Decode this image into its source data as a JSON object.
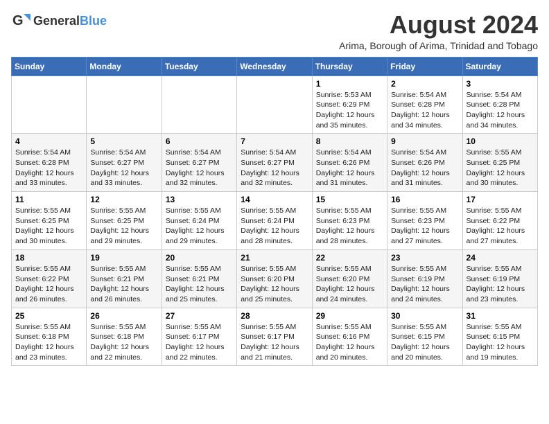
{
  "header": {
    "logo_general": "General",
    "logo_blue": "Blue",
    "main_title": "August 2024",
    "subtitle": "Arima, Borough of Arima, Trinidad and Tobago"
  },
  "days_of_week": [
    "Sunday",
    "Monday",
    "Tuesday",
    "Wednesday",
    "Thursday",
    "Friday",
    "Saturday"
  ],
  "weeks": [
    [
      {
        "day": "",
        "content": ""
      },
      {
        "day": "",
        "content": ""
      },
      {
        "day": "",
        "content": ""
      },
      {
        "day": "",
        "content": ""
      },
      {
        "day": "1",
        "content": "Sunrise: 5:53 AM\nSunset: 6:29 PM\nDaylight: 12 hours\nand 35 minutes."
      },
      {
        "day": "2",
        "content": "Sunrise: 5:54 AM\nSunset: 6:28 PM\nDaylight: 12 hours\nand 34 minutes."
      },
      {
        "day": "3",
        "content": "Sunrise: 5:54 AM\nSunset: 6:28 PM\nDaylight: 12 hours\nand 34 minutes."
      }
    ],
    [
      {
        "day": "4",
        "content": "Sunrise: 5:54 AM\nSunset: 6:28 PM\nDaylight: 12 hours\nand 33 minutes."
      },
      {
        "day": "5",
        "content": "Sunrise: 5:54 AM\nSunset: 6:27 PM\nDaylight: 12 hours\nand 33 minutes."
      },
      {
        "day": "6",
        "content": "Sunrise: 5:54 AM\nSunset: 6:27 PM\nDaylight: 12 hours\nand 32 minutes."
      },
      {
        "day": "7",
        "content": "Sunrise: 5:54 AM\nSunset: 6:27 PM\nDaylight: 12 hours\nand 32 minutes."
      },
      {
        "day": "8",
        "content": "Sunrise: 5:54 AM\nSunset: 6:26 PM\nDaylight: 12 hours\nand 31 minutes."
      },
      {
        "day": "9",
        "content": "Sunrise: 5:54 AM\nSunset: 6:26 PM\nDaylight: 12 hours\nand 31 minutes."
      },
      {
        "day": "10",
        "content": "Sunrise: 5:55 AM\nSunset: 6:25 PM\nDaylight: 12 hours\nand 30 minutes."
      }
    ],
    [
      {
        "day": "11",
        "content": "Sunrise: 5:55 AM\nSunset: 6:25 PM\nDaylight: 12 hours\nand 30 minutes."
      },
      {
        "day": "12",
        "content": "Sunrise: 5:55 AM\nSunset: 6:25 PM\nDaylight: 12 hours\nand 29 minutes."
      },
      {
        "day": "13",
        "content": "Sunrise: 5:55 AM\nSunset: 6:24 PM\nDaylight: 12 hours\nand 29 minutes."
      },
      {
        "day": "14",
        "content": "Sunrise: 5:55 AM\nSunset: 6:24 PM\nDaylight: 12 hours\nand 28 minutes."
      },
      {
        "day": "15",
        "content": "Sunrise: 5:55 AM\nSunset: 6:23 PM\nDaylight: 12 hours\nand 28 minutes."
      },
      {
        "day": "16",
        "content": "Sunrise: 5:55 AM\nSunset: 6:23 PM\nDaylight: 12 hours\nand 27 minutes."
      },
      {
        "day": "17",
        "content": "Sunrise: 5:55 AM\nSunset: 6:22 PM\nDaylight: 12 hours\nand 27 minutes."
      }
    ],
    [
      {
        "day": "18",
        "content": "Sunrise: 5:55 AM\nSunset: 6:22 PM\nDaylight: 12 hours\nand 26 minutes."
      },
      {
        "day": "19",
        "content": "Sunrise: 5:55 AM\nSunset: 6:21 PM\nDaylight: 12 hours\nand 26 minutes."
      },
      {
        "day": "20",
        "content": "Sunrise: 5:55 AM\nSunset: 6:21 PM\nDaylight: 12 hours\nand 25 minutes."
      },
      {
        "day": "21",
        "content": "Sunrise: 5:55 AM\nSunset: 6:20 PM\nDaylight: 12 hours\nand 25 minutes."
      },
      {
        "day": "22",
        "content": "Sunrise: 5:55 AM\nSunset: 6:20 PM\nDaylight: 12 hours\nand 24 minutes."
      },
      {
        "day": "23",
        "content": "Sunrise: 5:55 AM\nSunset: 6:19 PM\nDaylight: 12 hours\nand 24 minutes."
      },
      {
        "day": "24",
        "content": "Sunrise: 5:55 AM\nSunset: 6:19 PM\nDaylight: 12 hours\nand 23 minutes."
      }
    ],
    [
      {
        "day": "25",
        "content": "Sunrise: 5:55 AM\nSunset: 6:18 PM\nDaylight: 12 hours\nand 23 minutes."
      },
      {
        "day": "26",
        "content": "Sunrise: 5:55 AM\nSunset: 6:18 PM\nDaylight: 12 hours\nand 22 minutes."
      },
      {
        "day": "27",
        "content": "Sunrise: 5:55 AM\nSunset: 6:17 PM\nDaylight: 12 hours\nand 22 minutes."
      },
      {
        "day": "28",
        "content": "Sunrise: 5:55 AM\nSunset: 6:17 PM\nDaylight: 12 hours\nand 21 minutes."
      },
      {
        "day": "29",
        "content": "Sunrise: 5:55 AM\nSunset: 6:16 PM\nDaylight: 12 hours\nand 20 minutes."
      },
      {
        "day": "30",
        "content": "Sunrise: 5:55 AM\nSunset: 6:15 PM\nDaylight: 12 hours\nand 20 minutes."
      },
      {
        "day": "31",
        "content": "Sunrise: 5:55 AM\nSunset: 6:15 PM\nDaylight: 12 hours\nand 19 minutes."
      }
    ]
  ]
}
